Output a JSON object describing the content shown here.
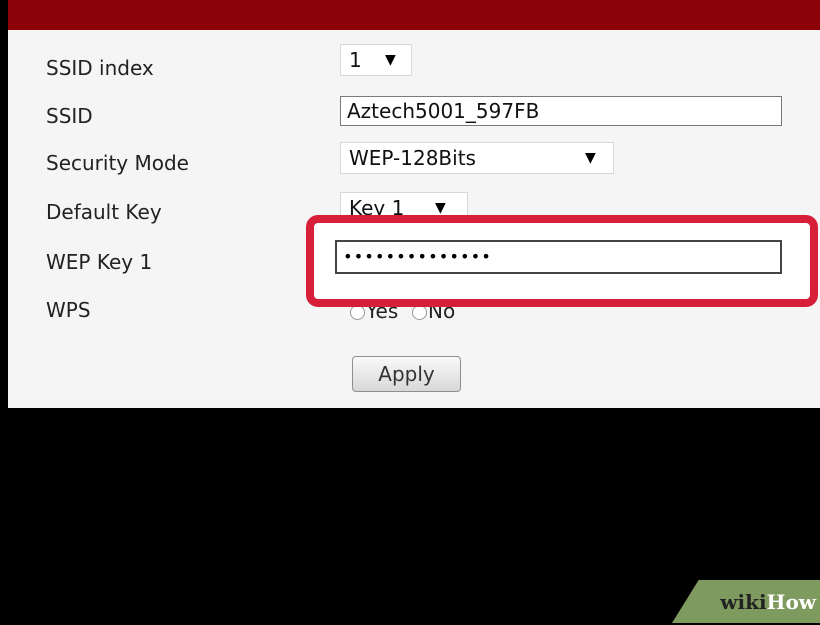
{
  "form": {
    "ssid_index": {
      "label": "SSID index",
      "value": "1"
    },
    "ssid": {
      "label": "SSID",
      "value": "Aztech5001_597FB"
    },
    "security_mode": {
      "label": "Security Mode",
      "value": "WEP-128Bits"
    },
    "default_key": {
      "label": "Default Key",
      "value": "Key 1"
    },
    "wep_key_1": {
      "label": "WEP Key 1",
      "value": "••••••••••••••"
    },
    "wps": {
      "label": "WPS",
      "options": [
        "Yes",
        "No"
      ]
    },
    "apply_label": "Apply"
  },
  "icons": {
    "dropdown": "triangle-down-icon",
    "radio": "radio-circle-icon"
  },
  "colors": {
    "header": "#8c0007",
    "highlight": "#d81f3a",
    "watermark": "#7f9a5e"
  },
  "watermark": {
    "part1": "wiki",
    "part2": "How"
  }
}
